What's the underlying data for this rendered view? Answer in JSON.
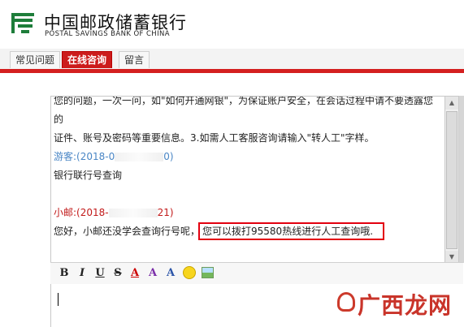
{
  "header": {
    "logo_cn": "中国邮政储蓄银行",
    "logo_en": "POSTAL SAVINGS BANK OF CHINA"
  },
  "tabs": [
    {
      "label": "常见问题"
    },
    {
      "label": "在线咨询",
      "active": true
    },
    {
      "label": "留言"
    }
  ],
  "chat": {
    "system_line1": "您的问题，一次一问，如\"如何开通网银\"，为保证账户安全，在会话过程中请不要透露您的",
    "system_line2": "证件、账号及密码等重要信息。3.如需人工客服咨询请输入\"转人工\"字样。",
    "guest_name": "游客:(2018-0",
    "guest_time_tail": "0)",
    "guest_msg": "银行联行号查询",
    "agent_name": "小邮:(2018-",
    "agent_time_tail": "21)",
    "agent_msg_a": "您好，小邮还没学会查询行号呢，",
    "agent_msg_b": "您可以拨打95580热线进行人工查询哦."
  },
  "toolbar": {
    "bold": "B",
    "italic": "I",
    "underline": "U",
    "strike": "S",
    "font_color": "A",
    "highlight": "A",
    "font_size": "A"
  },
  "icons": [
    "bold-icon",
    "italic-icon",
    "underline-icon",
    "strikethrough-icon",
    "font-color-icon",
    "highlight-icon",
    "font-size-icon",
    "emoji-icon",
    "image-icon"
  ],
  "colors": {
    "brand_red": "#d41f1f",
    "logo_green": "#1e7d3a",
    "guest_blue": "#4a86c5",
    "agent_red": "#c21a1a"
  },
  "watermark": "广西龙网"
}
